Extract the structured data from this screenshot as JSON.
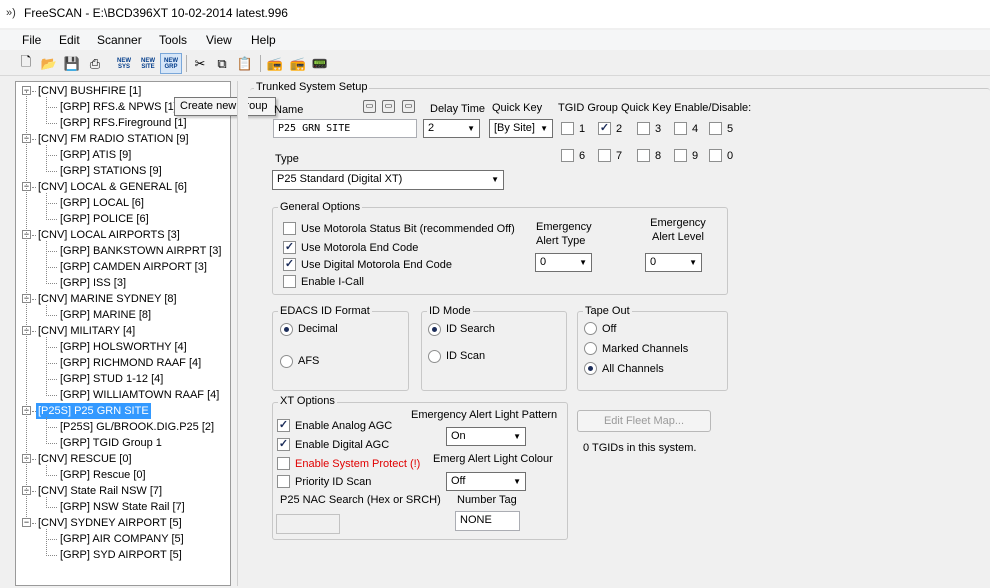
{
  "window": {
    "app_icon": "radio-waves-icon",
    "title": "FreeSCAN - E:\\BCD396XT 10-02-2014 latest.996"
  },
  "menu": [
    "File",
    "Edit",
    "Scanner",
    "Tools",
    "View",
    "Help"
  ],
  "toolbar": {
    "new_sys_label": "NEW SYS",
    "new_site_label": "NEW SITE",
    "new_grp_label": "NEW GRP",
    "tooltip": "Create new group"
  },
  "tree": [
    {
      "label": "[CNV] BUSHFIRE [1]",
      "level": 0
    },
    {
      "label": "[GRP] RFS.& NPWS [1]",
      "level": 1
    },
    {
      "label": "[GRP] RFS.Fireground [1]",
      "level": 1
    },
    {
      "label": "[CNV] FM RADIO STATION [9]",
      "level": 0
    },
    {
      "label": "[GRP] ATIS [9]",
      "level": 1
    },
    {
      "label": "[GRP] STATIONS [9]",
      "level": 1
    },
    {
      "label": "[CNV] LOCAL & GENERAL [6]",
      "level": 0
    },
    {
      "label": "[GRP] LOCAL [6]",
      "level": 1
    },
    {
      "label": "[GRP] POLICE [6]",
      "level": 1
    },
    {
      "label": "[CNV] LOCAL AIRPORTS [3]",
      "level": 0
    },
    {
      "label": "[GRP] BANKSTOWN AIRPRT [3]",
      "level": 1
    },
    {
      "label": "[GRP] CAMDEN AIRPORT [3]",
      "level": 1
    },
    {
      "label": "[GRP] ISS [3]",
      "level": 1
    },
    {
      "label": "[CNV] MARINE SYDNEY [8]",
      "level": 0
    },
    {
      "label": "[GRP] MARINE [8]",
      "level": 1
    },
    {
      "label": "[CNV] MILITARY [4]",
      "level": 0
    },
    {
      "label": "[GRP] HOLSWORTHY [4]",
      "level": 1
    },
    {
      "label": "[GRP] RICHMOND RAAF [4]",
      "level": 1
    },
    {
      "label": "[GRP] STUD 1-12 [4]",
      "level": 1
    },
    {
      "label": "[GRP] WILLIAMTOWN RAAF [4]",
      "level": 1
    },
    {
      "label": "[P25S] P25 GRN SITE",
      "level": 0,
      "selected": true
    },
    {
      "label": "[P25S] GL/BROOK.DIG.P25 [2]",
      "level": 1
    },
    {
      "label": "[GRP] TGID Group 1",
      "level": 1
    },
    {
      "label": "[CNV] RESCUE [0]",
      "level": 0
    },
    {
      "label": "[GRP] Rescue [0]",
      "level": 1
    },
    {
      "label": "[CNV] State Rail NSW [7]",
      "level": 0
    },
    {
      "label": "[GRP] NSW State Rail [7]",
      "level": 1
    },
    {
      "label": "[CNV] SYDNEY AIRPORT [5]",
      "level": 0
    },
    {
      "label": "[GRP] AIR COMPANY [5]",
      "level": 1
    },
    {
      "label": "[GRP] SYD AIRPORT [5]",
      "level": 1
    }
  ],
  "setup": {
    "section_title": "Trunked System Setup",
    "name_label": "Name",
    "name_value": "P25 GRN SITE",
    "delay_label": "Delay Time",
    "delay_value": "2",
    "quickkey_label": "Quick Key",
    "quickkey_value": "[By Site]",
    "tgid_label": "TGID Group Quick Key Enable/Disable:",
    "tgid_keys": [
      {
        "label": "1",
        "checked": false
      },
      {
        "label": "2",
        "checked": true
      },
      {
        "label": "3",
        "checked": false
      },
      {
        "label": "4",
        "checked": false
      },
      {
        "label": "5",
        "checked": false
      },
      {
        "label": "6",
        "checked": false
      },
      {
        "label": "7",
        "checked": false
      },
      {
        "label": "8",
        "checked": false
      },
      {
        "label": "9",
        "checked": false
      },
      {
        "label": "0",
        "checked": false
      }
    ],
    "type_label": "Type",
    "type_value": "P25 Standard (Digital XT)"
  },
  "general": {
    "title": "General Options",
    "opt1": "Use Motorola Status Bit (recommended Off)",
    "opt2": "Use Motorola End Code",
    "opt3": "Use Digital  Motorola End Code",
    "opt4": "Enable I-Call",
    "alert_type_label": "Emergency Alert Type",
    "alert_type_value": "0",
    "alert_level_label": "Emergency Alert Level",
    "alert_level_value": "0"
  },
  "edacs": {
    "title": "EDACS ID Format",
    "opt1": "Decimal",
    "opt2": "AFS"
  },
  "idmode": {
    "title": "ID Mode",
    "opt1": "ID Search",
    "opt2": "ID Scan"
  },
  "tape": {
    "title": "Tape Out",
    "opt1": "Off",
    "opt2": "Marked Channels",
    "opt3": "All Channels"
  },
  "xt": {
    "title": "XT  Options",
    "opt1": "Enable Analog AGC",
    "opt2": "Enable Digital AGC",
    "opt3": "Enable System Protect (!)",
    "opt4": "Priority ID Scan",
    "light_pattern_label": "Emergency Alert Light Pattern",
    "light_pattern_value": "On",
    "light_colour_label": "Emerg Alert Light Colour",
    "light_colour_value": "Off",
    "nac_label": "P25 NAC Search (Hex or SRCH)",
    "nac_value": "",
    "number_tag_label": "Number Tag",
    "number_tag_value": "NONE"
  },
  "fleet": {
    "button": "Edit Fleet Map...",
    "info": "0 TGIDs in this system."
  },
  "colors": {
    "selection": "#3399ff",
    "warning_text": "#e00000",
    "check": "#1c2d5a"
  }
}
